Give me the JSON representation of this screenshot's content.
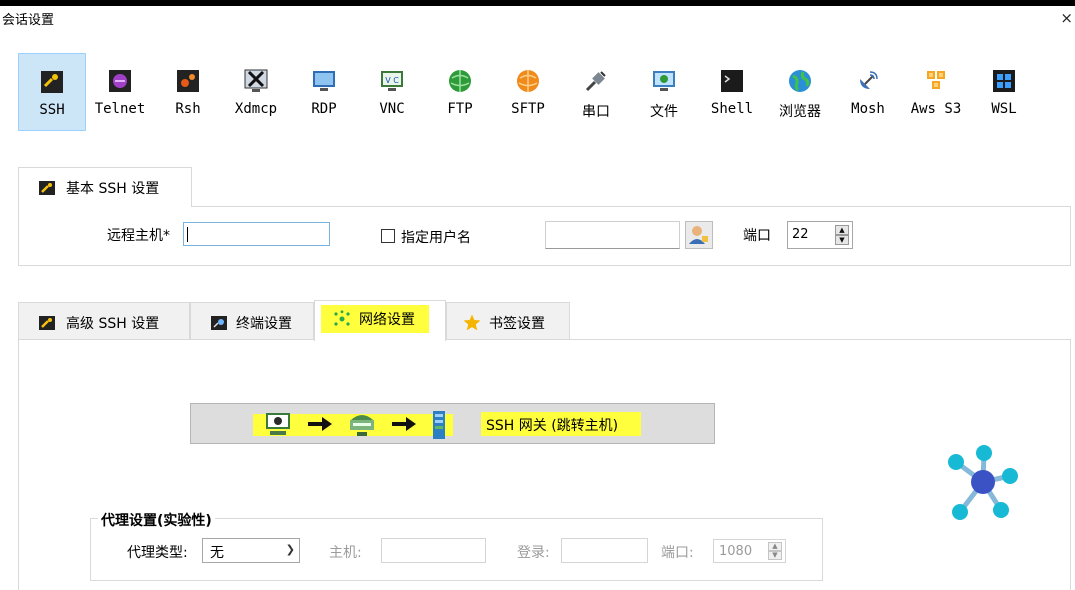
{
  "window": {
    "title": "会话设置",
    "close_glyph": "×"
  },
  "session_types": [
    {
      "label": "SSH",
      "icon": "ssh-key-icon",
      "selected": true
    },
    {
      "label": "Telnet",
      "icon": "telnet-icon"
    },
    {
      "label": "Rsh",
      "icon": "rsh-icon"
    },
    {
      "label": "Xdmcp",
      "icon": "xdmcp-icon"
    },
    {
      "label": "RDP",
      "icon": "rdp-monitor-icon"
    },
    {
      "label": "VNC",
      "icon": "vnc-icon"
    },
    {
      "label": "FTP",
      "icon": "ftp-globe-icon"
    },
    {
      "label": "SFTP",
      "icon": "sftp-globe-icon"
    },
    {
      "label": "串口",
      "icon": "serial-plug-icon"
    },
    {
      "label": "文件",
      "icon": "file-monitor-icon"
    },
    {
      "label": "Shell",
      "icon": "shell-terminal-icon"
    },
    {
      "label": "浏览器",
      "icon": "browser-globe-icon"
    },
    {
      "label": "Mosh",
      "icon": "mosh-satellite-icon"
    },
    {
      "label": "Aws S3",
      "icon": "aws-s3-cubes-icon"
    },
    {
      "label": "WSL",
      "icon": "wsl-windows-icon"
    }
  ],
  "basic": {
    "tab_label": "基本 SSH 设置",
    "remote_host_label": "远程主机*",
    "remote_host_value": "",
    "specify_user_label": "指定用户名",
    "specify_user_checked": false,
    "username_value": "",
    "port_label": "端口",
    "port_value": "22"
  },
  "advanced_tabs": [
    {
      "label": "高级 SSH 设置",
      "icon": "wrench-key-icon"
    },
    {
      "label": "终端设置",
      "icon": "terminal-settings-icon"
    },
    {
      "label": "网络设置",
      "icon": "network-icon",
      "active": true,
      "highlighted": true
    },
    {
      "label": "书签设置",
      "icon": "star-icon"
    }
  ],
  "network": {
    "gateway_button_label": "SSH 网关 (跳转主机)",
    "proxy_group_title": "代理设置(实验性)",
    "proxy_type_label": "代理类型:",
    "proxy_type_value": "无",
    "proxy_host_label": "主机:",
    "proxy_login_label": "登录:",
    "proxy_port_label": "端口:",
    "proxy_port_value": "1080"
  },
  "colors": {
    "highlight": "#ffff3d",
    "selected_bg": "#cde6f7",
    "accent_blue": "#7ab4dc"
  }
}
